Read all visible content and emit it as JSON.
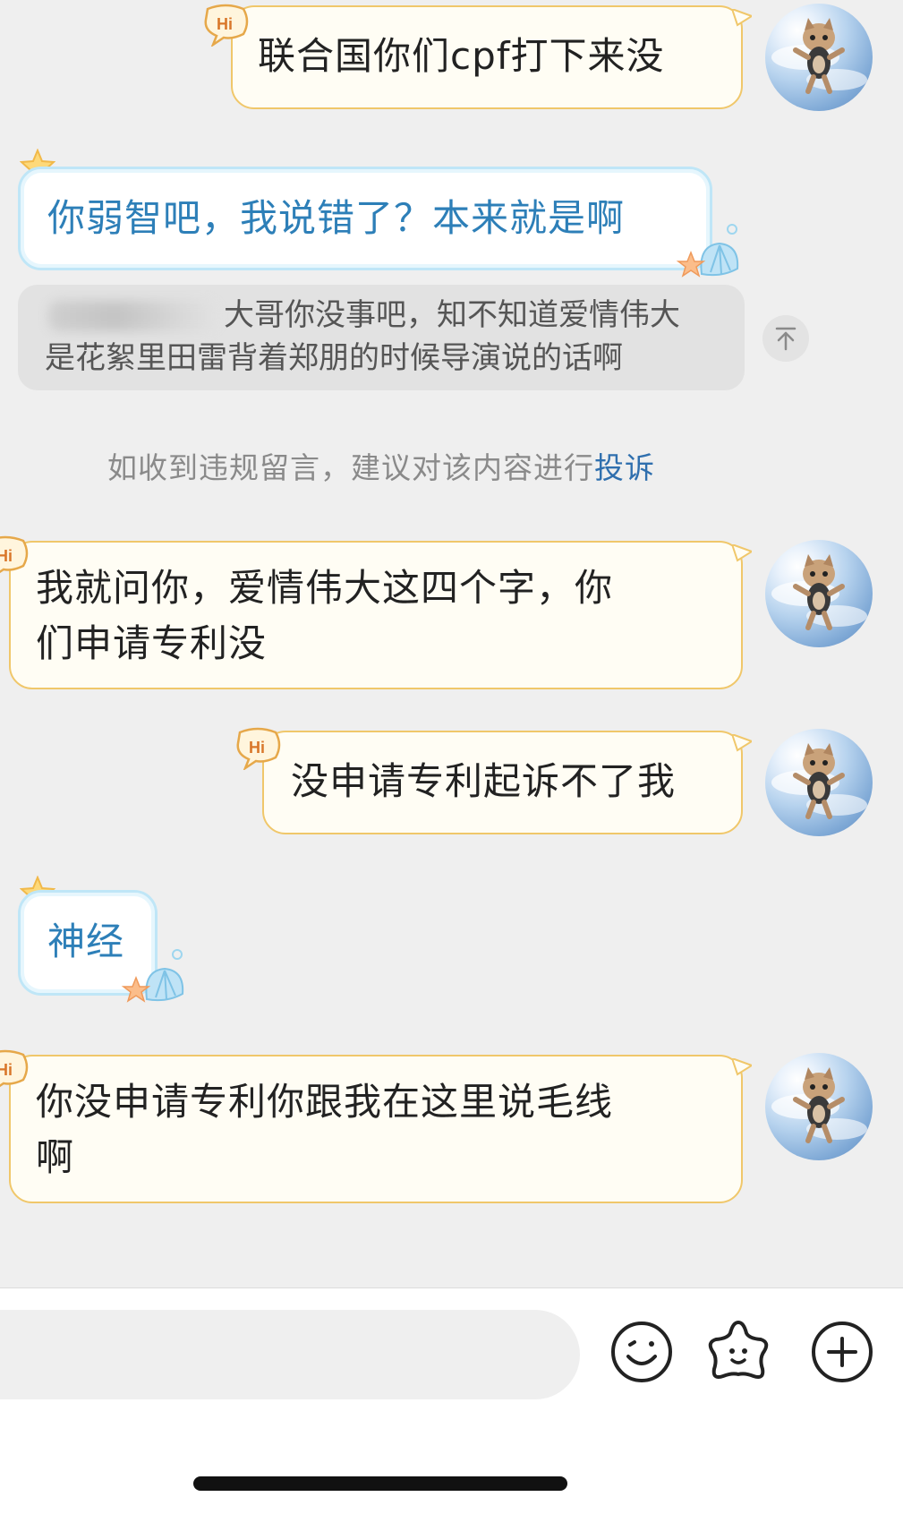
{
  "messages": [
    {
      "side": "me",
      "text": "联合国你们cpf打下来没"
    },
    {
      "side": "other",
      "text": "你弱智吧，我说错了？本来就是啊",
      "quote": {
        "line1": "大哥你没事吧，知不知道爱情伟大",
        "line2": "是花絮里田雷背着郑朋的时候导演说的话啊"
      }
    },
    {
      "side": "me",
      "lines": [
        "我就问你，爱情伟大这四个字，你",
        "们申请专利没"
      ]
    },
    {
      "side": "me",
      "text": "没申请专利起诉不了我"
    },
    {
      "side": "other",
      "text": "神经"
    },
    {
      "side": "me",
      "lines": [
        "你没申请专利你跟我在这里说毛线",
        "啊"
      ]
    }
  ],
  "notice": {
    "text": "如收到违规留言，建议对该内容进行",
    "link": "投诉"
  },
  "badge": {
    "hi": "Hi"
  },
  "input": {
    "placeholder": ""
  },
  "colors": {
    "me_border": "#f0c76a",
    "other_text": "#2d7fb8",
    "link": "#2f6fae"
  },
  "icons": {
    "emoji": "smiley-icon",
    "sticker": "star-face-icon",
    "more": "plus-circle-icon",
    "pin": "pin-top-icon"
  }
}
